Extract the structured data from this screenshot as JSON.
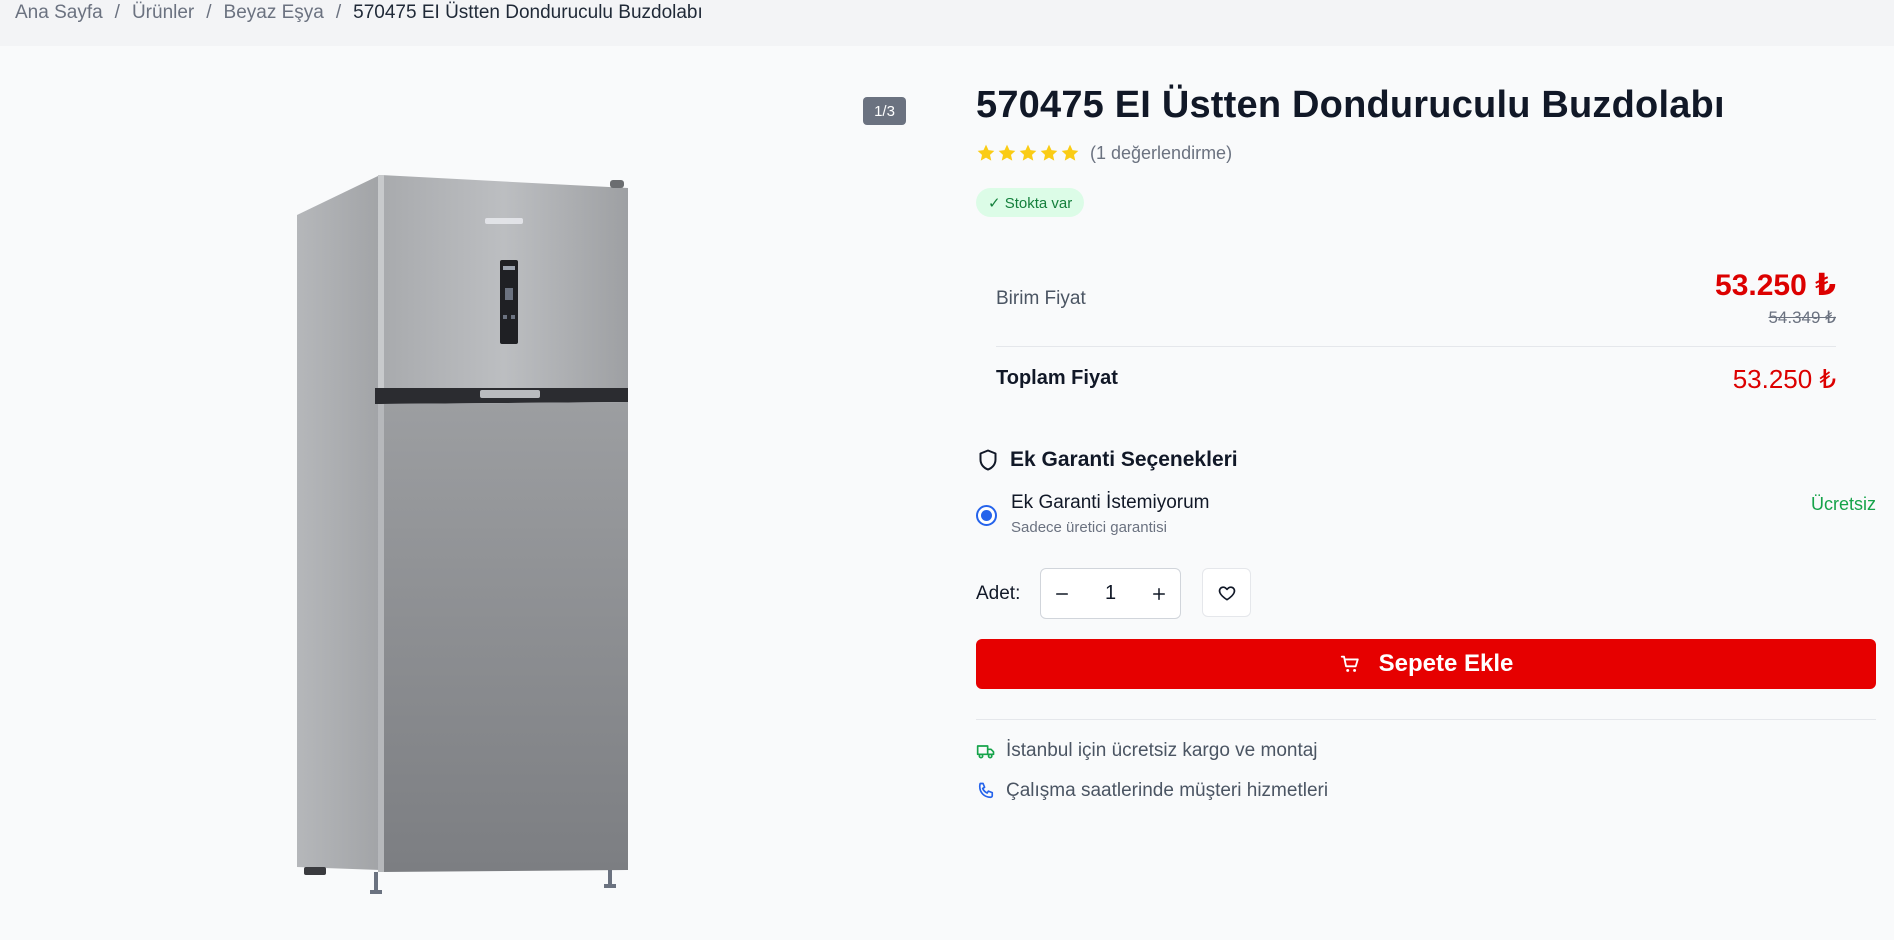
{
  "breadcrumb": {
    "items": [
      "Ana Sayfa",
      "Ürünler",
      "Beyaz Eşya"
    ],
    "separator": "/",
    "current": "570475 EI Üstten Donduruculu Buzdolabı"
  },
  "gallery": {
    "counter": "1/3",
    "image_alt": "fridge-product-image"
  },
  "product": {
    "title": "570475 EI Üstten Donduruculu Buzdolabı",
    "rating": 5,
    "review_count_text": "(1 değerlendirme)",
    "stock_text": "✓ Stokta var"
  },
  "pricing": {
    "unit_label": "Birim Fiyat",
    "unit_price": "53.250 ₺",
    "old_price": "54.349 ₺",
    "total_label": "Toplam Fiyat",
    "total_price": "53.250 ₺"
  },
  "warranty": {
    "title": "Ek Garanti Seçenekleri",
    "option": {
      "title": "Ek Garanti İstemiyorum",
      "subtitle": "Sadece üretici garantisi",
      "price": "Ücretsiz",
      "selected": true
    }
  },
  "quantity": {
    "label": "Adet:",
    "value": "1"
  },
  "cart": {
    "button_label": "Sepete Ekle"
  },
  "info": {
    "shipping": "İstanbul için ücretsiz kargo ve montaj",
    "support": "Çalışma saatlerinde müşteri hizmetleri"
  },
  "colors": {
    "accent_red": "#e60000",
    "price_red": "#dc0000",
    "success_green": "#16a34a",
    "radio_blue": "#2563eb",
    "star_yellow": "#facc15"
  },
  "icons": [
    "shield-icon",
    "cart-icon",
    "heart-icon",
    "minus-icon",
    "plus-icon",
    "truck-icon",
    "phone-icon",
    "star-icon"
  ]
}
